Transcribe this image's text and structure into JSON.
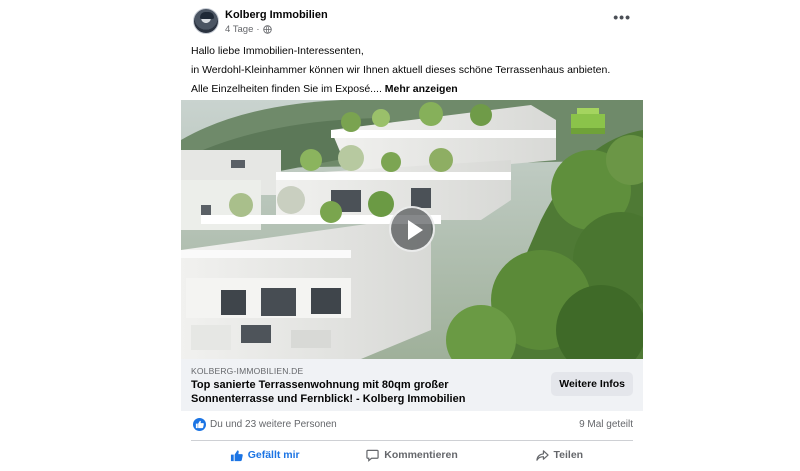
{
  "post": {
    "page_name": "Kolberg Immobilien",
    "time": "4 Tage",
    "separator": "·",
    "more_icon": "more-options-icon",
    "text_lines": [
      "Hallo liebe Immobilien-Interessenten,",
      "in Werdohl-Kleinhammer können wir Ihnen aktuell dieses schöne Terrassenhaus anbieten.",
      "Alle Einzelheiten finden Sie im Exposé...."
    ],
    "see_more": "Mehr anzeigen"
  },
  "link_preview": {
    "domain": "KOLBERG-IMMOBILIEN.DE",
    "title": "Top sanierte Terrassenwohnung mit 80qm großer Sonnenterrasse und Fernblick! - Kolberg Immobilien",
    "cta": "Weitere Infos"
  },
  "stats": {
    "reactions": "Du und 23 weitere Personen",
    "shares": "9 Mal geteilt"
  },
  "actions": {
    "like": "Gefällt mir",
    "comment": "Kommentieren",
    "share": "Teilen"
  },
  "colors": {
    "accent": "#1b74e4",
    "secondary_text": "#65676b",
    "preview_bg": "#f0f2f5"
  }
}
